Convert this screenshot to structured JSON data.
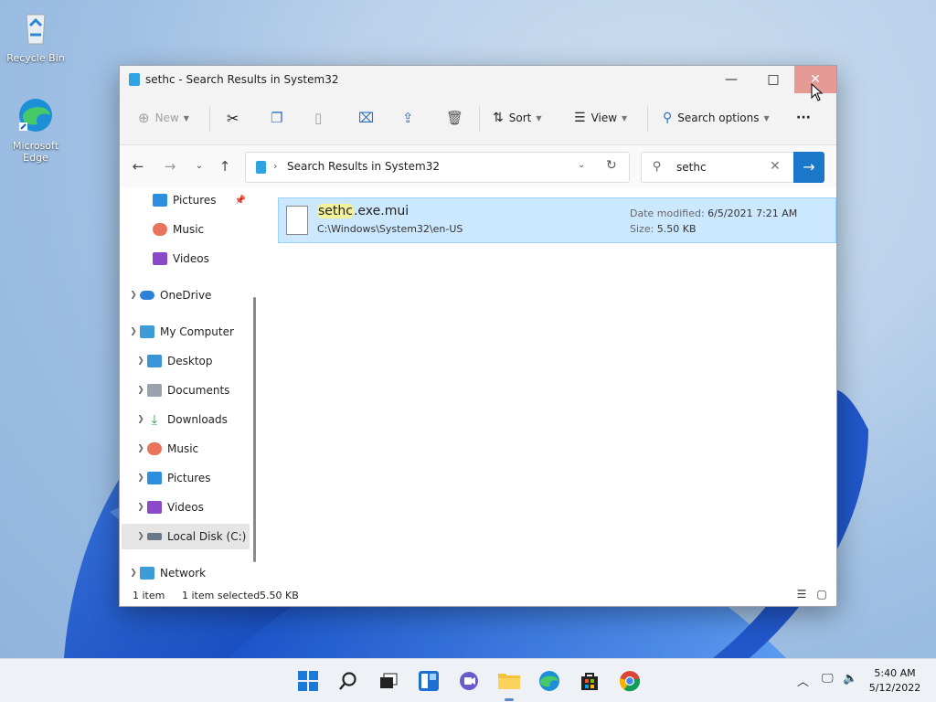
{
  "desktop": {
    "icons": [
      {
        "label": "Recycle Bin"
      },
      {
        "label": "Microsoft Edge"
      }
    ]
  },
  "window": {
    "title": "sethc - Search Results in System32",
    "controls": {
      "minimize": "—",
      "maximize": "□",
      "close": "✕"
    }
  },
  "toolbar": {
    "new_label": "New",
    "sort_label": "Sort",
    "view_label": "View",
    "search_options_label": "Search options",
    "more_label": "···"
  },
  "nav": {
    "address_path": "Search Results in System32",
    "search_value": "sethc"
  },
  "sidebar": {
    "items": [
      {
        "label": "Pictures"
      },
      {
        "label": "Music"
      },
      {
        "label": "Videos"
      },
      {
        "label": "OneDrive"
      },
      {
        "label": "My Computer"
      },
      {
        "label": "Desktop"
      },
      {
        "label": "Documents"
      },
      {
        "label": "Downloads"
      },
      {
        "label": "Music"
      },
      {
        "label": "Pictures"
      },
      {
        "label": "Videos"
      },
      {
        "label": "Local Disk (C:)"
      },
      {
        "label": "Network"
      }
    ]
  },
  "results": [
    {
      "name_match": "sethc",
      "name_rest": ".exe.mui",
      "path": "C:\\Windows\\System32\\en-US",
      "date_key": "Date modified:",
      "date_value": "6/5/2021 7:21 AM",
      "size_key": "Size:",
      "size_value": "5.50 KB"
    }
  ],
  "status": {
    "count": "1 item",
    "selected": "1 item selected",
    "size": "5.50 KB"
  },
  "clock": {
    "time": "5:40 AM",
    "date": "5/12/2022"
  },
  "colors": {
    "accent": "#1a77c9",
    "selection": "#cce8ff",
    "close_hover": "#e59a96"
  }
}
